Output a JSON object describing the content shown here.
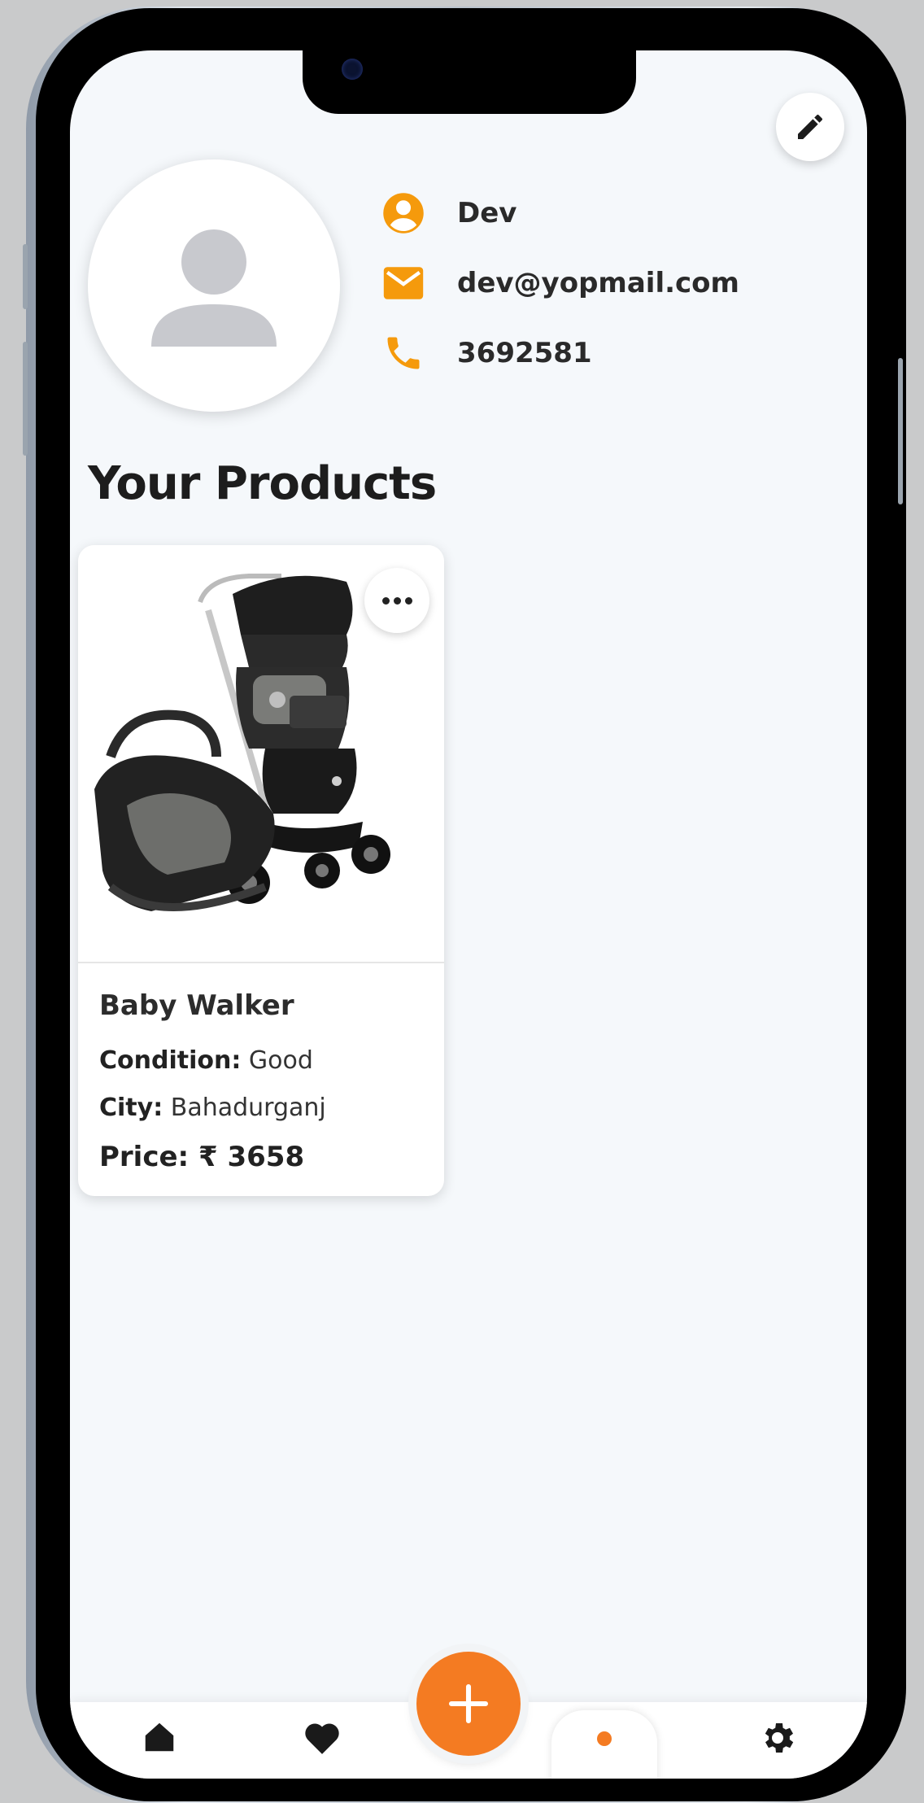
{
  "profile": {
    "name": "Dev",
    "email": "dev@yopmail.com",
    "phone": "3692581"
  },
  "products_section": {
    "title": "Your Products"
  },
  "products": [
    {
      "name": "Baby Walker",
      "condition_label": "Condition:",
      "condition_value": "Good",
      "city_label": "City:",
      "city_value": "Bahadurganj",
      "price_label": "Price:",
      "price_value": "₹ 3658"
    }
  ],
  "bottom_nav": {
    "items": [
      "home-icon",
      "heart-icon",
      "profile-icon",
      "settings-icon"
    ],
    "active": "profile-icon"
  },
  "colors": {
    "accent": "#f47b22",
    "background": "#f5f8fb",
    "text": "#2a2a2a"
  }
}
